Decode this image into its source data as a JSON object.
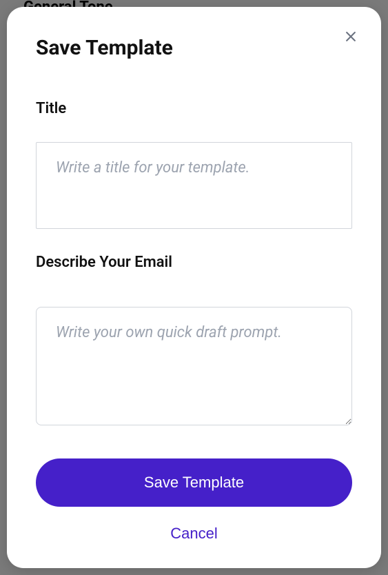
{
  "background": {
    "partial_text": "General Tone"
  },
  "modal": {
    "title": "Save Template",
    "fields": {
      "title": {
        "label": "Title",
        "placeholder": "Write a title for your template.",
        "value": ""
      },
      "description": {
        "label": "Describe Your Email",
        "placeholder": "Write your own quick draft prompt.",
        "value": ""
      }
    },
    "buttons": {
      "save": "Save Template",
      "cancel": "Cancel"
    }
  }
}
